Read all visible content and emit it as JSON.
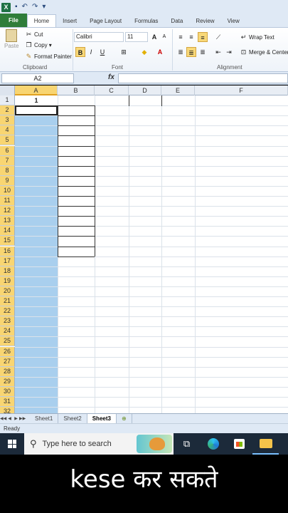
{
  "title_bar": {
    "app_logo": "X",
    "icons": [
      "save-icon",
      "undo-icon",
      "redo-icon",
      "customize-icon"
    ]
  },
  "ribbon_tabs": [
    "File",
    "Home",
    "Insert",
    "Page Layout",
    "Formulas",
    "Data",
    "Review",
    "View"
  ],
  "ribbon": {
    "clipboard": {
      "paste": "Paste",
      "cut": "Cut",
      "copy": "Copy",
      "format_painter": "Format Painter",
      "label": "Clipboard"
    },
    "font": {
      "name": "Calibri",
      "size": "11",
      "label": "Font",
      "bold": "B",
      "italic": "I",
      "underline": "U",
      "grow": "A",
      "shrink": "A",
      "font_color": "A"
    },
    "alignment": {
      "wrap_text": "Wrap Text",
      "merge": "Merge & Center",
      "label": "Alignment"
    }
  },
  "formula_bar": {
    "name_box": "A2",
    "fx": "fx",
    "value": ""
  },
  "grid": {
    "columns": [
      "A",
      "B",
      "C",
      "D",
      "E",
      "F"
    ],
    "rows": [
      "1",
      "2",
      "3",
      "4",
      "5",
      "6",
      "7",
      "8",
      "9",
      "10",
      "11",
      "12",
      "13",
      "14",
      "15",
      "16",
      "17",
      "18",
      "19",
      "20",
      "21",
      "22",
      "23",
      "24",
      "25",
      "26",
      "27",
      "28",
      "29",
      "30",
      "31",
      "32"
    ],
    "cell_A1": "1",
    "selected_column": "A",
    "colors": {
      "selection": "#a9cfee",
      "header_highlight": "#f8d572"
    }
  },
  "sheets": {
    "tabs": [
      "Sheet1",
      "Sheet2",
      "Sheet3"
    ],
    "active": "Sheet3"
  },
  "status": "Ready",
  "taskbar": {
    "search_placeholder": "Type here to search",
    "icons": [
      "windows-icon",
      "task-view-icon",
      "edge-icon",
      "store-icon",
      "file-explorer-icon"
    ]
  },
  "caption": "kese कर सकते"
}
